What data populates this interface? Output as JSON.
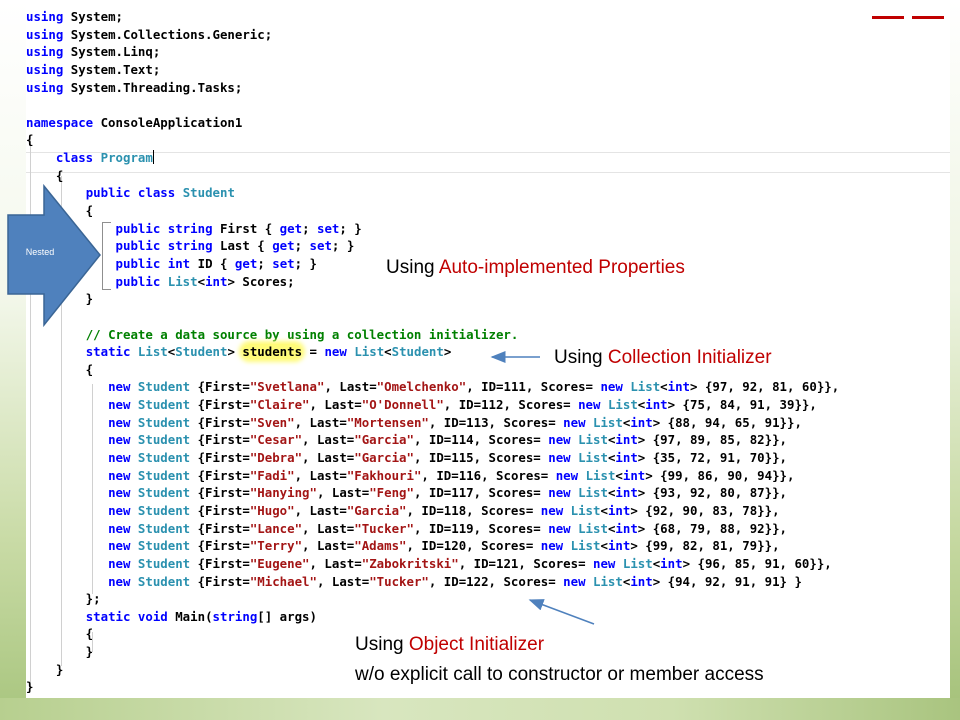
{
  "code_lines": [
    [
      {
        "t": "using",
        "c": "kw"
      },
      {
        "t": " System;"
      }
    ],
    [
      {
        "t": "using",
        "c": "kw"
      },
      {
        "t": " System.Collections.Generic;"
      }
    ],
    [
      {
        "t": "using",
        "c": "kw"
      },
      {
        "t": " System.Linq;"
      }
    ],
    [
      {
        "t": "using",
        "c": "kw"
      },
      {
        "t": " System.Text;"
      }
    ],
    [
      {
        "t": "using",
        "c": "kw"
      },
      {
        "t": " System.Threading.Tasks;"
      }
    ],
    [],
    [
      {
        "t": "namespace",
        "c": "kw"
      },
      {
        "t": " ConsoleApplication1"
      }
    ],
    [
      {
        "t": "{"
      }
    ],
    [
      {
        "t": "    "
      },
      {
        "t": "class",
        "c": "kw"
      },
      {
        "t": " "
      },
      {
        "t": "Program",
        "c": "ty"
      },
      {
        "caret": true
      }
    ],
    [
      {
        "t": "    {"
      }
    ],
    [
      {
        "t": "        "
      },
      {
        "t": "public",
        "c": "kw"
      },
      {
        "t": " "
      },
      {
        "t": "class",
        "c": "kw"
      },
      {
        "t": " "
      },
      {
        "t": "Student",
        "c": "ty"
      }
    ],
    [
      {
        "t": "        {"
      }
    ],
    [
      {
        "t": "            "
      },
      {
        "t": "public",
        "c": "kw"
      },
      {
        "t": " "
      },
      {
        "t": "string",
        "c": "kw"
      },
      {
        "t": " First { "
      },
      {
        "t": "get",
        "c": "kw"
      },
      {
        "t": "; "
      },
      {
        "t": "set",
        "c": "kw"
      },
      {
        "t": "; }"
      }
    ],
    [
      {
        "t": "            "
      },
      {
        "t": "public",
        "c": "kw"
      },
      {
        "t": " "
      },
      {
        "t": "string",
        "c": "kw"
      },
      {
        "t": " Last { "
      },
      {
        "t": "get",
        "c": "kw"
      },
      {
        "t": "; "
      },
      {
        "t": "set",
        "c": "kw"
      },
      {
        "t": "; }"
      }
    ],
    [
      {
        "t": "            "
      },
      {
        "t": "public",
        "c": "kw"
      },
      {
        "t": " "
      },
      {
        "t": "int",
        "c": "kw"
      },
      {
        "t": " ID { "
      },
      {
        "t": "get",
        "c": "kw"
      },
      {
        "t": "; "
      },
      {
        "t": "set",
        "c": "kw"
      },
      {
        "t": "; }"
      }
    ],
    [
      {
        "t": "            "
      },
      {
        "t": "public",
        "c": "kw"
      },
      {
        "t": " "
      },
      {
        "t": "List",
        "c": "ty"
      },
      {
        "t": "<"
      },
      {
        "t": "int",
        "c": "kw"
      },
      {
        "t": "> Scores;"
      }
    ],
    [
      {
        "t": "        }"
      }
    ],
    [],
    [
      {
        "t": "        "
      },
      {
        "t": "// Create a data source by using a collection initializer.",
        "c": "cm"
      }
    ],
    [
      {
        "t": "        "
      },
      {
        "t": "static",
        "c": "kw"
      },
      {
        "t": " "
      },
      {
        "t": "List",
        "c": "ty"
      },
      {
        "t": "<"
      },
      {
        "t": "Student",
        "c": "ty"
      },
      {
        "t": "> "
      },
      {
        "t": "students",
        "hl": true
      },
      {
        "t": " = "
      },
      {
        "t": "new",
        "c": "kw"
      },
      {
        "t": " "
      },
      {
        "t": "List",
        "c": "ty"
      },
      {
        "t": "<"
      },
      {
        "t": "Student",
        "c": "ty"
      },
      {
        "t": ">"
      }
    ],
    [
      {
        "t": "        {"
      }
    ],
    [
      {
        "t": "           "
      },
      {
        "t": "new",
        "c": "kw"
      },
      {
        "t": " "
      },
      {
        "t": "Student",
        "c": "ty"
      },
      {
        "t": " {First="
      },
      {
        "t": "\"Svetlana\"",
        "c": "st"
      },
      {
        "t": ", Last="
      },
      {
        "t": "\"Omelchenko\"",
        "c": "st"
      },
      {
        "t": ", ID=111, Scores= "
      },
      {
        "t": "new",
        "c": "kw"
      },
      {
        "t": " "
      },
      {
        "t": "List",
        "c": "ty"
      },
      {
        "t": "<"
      },
      {
        "t": "int",
        "c": "kw"
      },
      {
        "t": "> {97, 92, 81, 60}},"
      }
    ],
    [
      {
        "t": "           "
      },
      {
        "t": "new",
        "c": "kw"
      },
      {
        "t": " "
      },
      {
        "t": "Student",
        "c": "ty"
      },
      {
        "t": " {First="
      },
      {
        "t": "\"Claire\"",
        "c": "st"
      },
      {
        "t": ", Last="
      },
      {
        "t": "\"O'Donnell\"",
        "c": "st"
      },
      {
        "t": ", ID=112, Scores= "
      },
      {
        "t": "new",
        "c": "kw"
      },
      {
        "t": " "
      },
      {
        "t": "List",
        "c": "ty"
      },
      {
        "t": "<"
      },
      {
        "t": "int",
        "c": "kw"
      },
      {
        "t": "> {75, 84, 91, 39}},"
      }
    ],
    [
      {
        "t": "           "
      },
      {
        "t": "new",
        "c": "kw"
      },
      {
        "t": " "
      },
      {
        "t": "Student",
        "c": "ty"
      },
      {
        "t": " {First="
      },
      {
        "t": "\"Sven\"",
        "c": "st"
      },
      {
        "t": ", Last="
      },
      {
        "t": "\"Mortensen\"",
        "c": "st"
      },
      {
        "t": ", ID=113, Scores= "
      },
      {
        "t": "new",
        "c": "kw"
      },
      {
        "t": " "
      },
      {
        "t": "List",
        "c": "ty"
      },
      {
        "t": "<"
      },
      {
        "t": "int",
        "c": "kw"
      },
      {
        "t": "> {88, 94, 65, 91}},"
      }
    ],
    [
      {
        "t": "           "
      },
      {
        "t": "new",
        "c": "kw"
      },
      {
        "t": " "
      },
      {
        "t": "Student",
        "c": "ty"
      },
      {
        "t": " {First="
      },
      {
        "t": "\"Cesar\"",
        "c": "st"
      },
      {
        "t": ", Last="
      },
      {
        "t": "\"Garcia\"",
        "c": "st"
      },
      {
        "t": ", ID=114, Scores= "
      },
      {
        "t": "new",
        "c": "kw"
      },
      {
        "t": " "
      },
      {
        "t": "List",
        "c": "ty"
      },
      {
        "t": "<"
      },
      {
        "t": "int",
        "c": "kw"
      },
      {
        "t": "> {97, 89, 85, 82}},"
      }
    ],
    [
      {
        "t": "           "
      },
      {
        "t": "new",
        "c": "kw"
      },
      {
        "t": " "
      },
      {
        "t": "Student",
        "c": "ty"
      },
      {
        "t": " {First="
      },
      {
        "t": "\"Debra\"",
        "c": "st"
      },
      {
        "t": ", Last="
      },
      {
        "t": "\"Garcia\"",
        "c": "st"
      },
      {
        "t": ", ID=115, Scores= "
      },
      {
        "t": "new",
        "c": "kw"
      },
      {
        "t": " "
      },
      {
        "t": "List",
        "c": "ty"
      },
      {
        "t": "<"
      },
      {
        "t": "int",
        "c": "kw"
      },
      {
        "t": "> {35, 72, 91, 70}},"
      }
    ],
    [
      {
        "t": "           "
      },
      {
        "t": "new",
        "c": "kw"
      },
      {
        "t": " "
      },
      {
        "t": "Student",
        "c": "ty"
      },
      {
        "t": " {First="
      },
      {
        "t": "\"Fadi\"",
        "c": "st"
      },
      {
        "t": ", Last="
      },
      {
        "t": "\"Fakhouri\"",
        "c": "st"
      },
      {
        "t": ", ID=116, Scores= "
      },
      {
        "t": "new",
        "c": "kw"
      },
      {
        "t": " "
      },
      {
        "t": "List",
        "c": "ty"
      },
      {
        "t": "<"
      },
      {
        "t": "int",
        "c": "kw"
      },
      {
        "t": "> {99, 86, 90, 94}},"
      }
    ],
    [
      {
        "t": "           "
      },
      {
        "t": "new",
        "c": "kw"
      },
      {
        "t": " "
      },
      {
        "t": "Student",
        "c": "ty"
      },
      {
        "t": " {First="
      },
      {
        "t": "\"Hanying\"",
        "c": "st"
      },
      {
        "t": ", Last="
      },
      {
        "t": "\"Feng\"",
        "c": "st"
      },
      {
        "t": ", ID=117, Scores= "
      },
      {
        "t": "new",
        "c": "kw"
      },
      {
        "t": " "
      },
      {
        "t": "List",
        "c": "ty"
      },
      {
        "t": "<"
      },
      {
        "t": "int",
        "c": "kw"
      },
      {
        "t": "> {93, 92, 80, 87}},"
      }
    ],
    [
      {
        "t": "           "
      },
      {
        "t": "new",
        "c": "kw"
      },
      {
        "t": " "
      },
      {
        "t": "Student",
        "c": "ty"
      },
      {
        "t": " {First="
      },
      {
        "t": "\"Hugo\"",
        "c": "st"
      },
      {
        "t": ", Last="
      },
      {
        "t": "\"Garcia\"",
        "c": "st"
      },
      {
        "t": ", ID=118, Scores= "
      },
      {
        "t": "new",
        "c": "kw"
      },
      {
        "t": " "
      },
      {
        "t": "List",
        "c": "ty"
      },
      {
        "t": "<"
      },
      {
        "t": "int",
        "c": "kw"
      },
      {
        "t": "> {92, 90, 83, 78}},"
      }
    ],
    [
      {
        "t": "           "
      },
      {
        "t": "new",
        "c": "kw"
      },
      {
        "t": " "
      },
      {
        "t": "Student",
        "c": "ty"
      },
      {
        "t": " {First="
      },
      {
        "t": "\"Lance\"",
        "c": "st"
      },
      {
        "t": ", Last="
      },
      {
        "t": "\"Tucker\"",
        "c": "st"
      },
      {
        "t": ", ID=119, Scores= "
      },
      {
        "t": "new",
        "c": "kw"
      },
      {
        "t": " "
      },
      {
        "t": "List",
        "c": "ty"
      },
      {
        "t": "<"
      },
      {
        "t": "int",
        "c": "kw"
      },
      {
        "t": "> {68, 79, 88, 92}},"
      }
    ],
    [
      {
        "t": "           "
      },
      {
        "t": "new",
        "c": "kw"
      },
      {
        "t": " "
      },
      {
        "t": "Student",
        "c": "ty"
      },
      {
        "t": " {First="
      },
      {
        "t": "\"Terry\"",
        "c": "st"
      },
      {
        "t": ", Last="
      },
      {
        "t": "\"Adams\"",
        "c": "st"
      },
      {
        "t": ", ID=120, Scores= "
      },
      {
        "t": "new",
        "c": "kw"
      },
      {
        "t": " "
      },
      {
        "t": "List",
        "c": "ty"
      },
      {
        "t": "<"
      },
      {
        "t": "int",
        "c": "kw"
      },
      {
        "t": "> {99, 82, 81, 79}},"
      }
    ],
    [
      {
        "t": "           "
      },
      {
        "t": "new",
        "c": "kw"
      },
      {
        "t": " "
      },
      {
        "t": "Student",
        "c": "ty"
      },
      {
        "t": " {First="
      },
      {
        "t": "\"Eugene\"",
        "c": "st"
      },
      {
        "t": ", Last="
      },
      {
        "t": "\"Zabokritski\"",
        "c": "st"
      },
      {
        "t": ", ID=121, Scores= "
      },
      {
        "t": "new",
        "c": "kw"
      },
      {
        "t": " "
      },
      {
        "t": "List",
        "c": "ty"
      },
      {
        "t": "<"
      },
      {
        "t": "int",
        "c": "kw"
      },
      {
        "t": "> {96, 85, 91, 60}},"
      }
    ],
    [
      {
        "t": "           "
      },
      {
        "t": "new",
        "c": "kw"
      },
      {
        "t": " "
      },
      {
        "t": "Student",
        "c": "ty"
      },
      {
        "t": " {First="
      },
      {
        "t": "\"Michael\"",
        "c": "st"
      },
      {
        "t": ", Last="
      },
      {
        "t": "\"Tucker\"",
        "c": "st"
      },
      {
        "t": ", ID=122, Scores= "
      },
      {
        "t": "new",
        "c": "kw"
      },
      {
        "t": " "
      },
      {
        "t": "List",
        "c": "ty"
      },
      {
        "t": "<"
      },
      {
        "t": "int",
        "c": "kw"
      },
      {
        "t": "> {94, 92, 91, 91} }"
      }
    ],
    [
      {
        "t": "        };"
      }
    ],
    [
      {
        "t": "        "
      },
      {
        "t": "static",
        "c": "kw"
      },
      {
        "t": " "
      },
      {
        "t": "void",
        "c": "kw"
      },
      {
        "t": " Main("
      },
      {
        "t": "string",
        "c": "kw"
      },
      {
        "t": "[] args)"
      }
    ],
    [
      {
        "t": "        {"
      }
    ],
    [
      {
        "t": "        }"
      }
    ],
    [
      {
        "t": "    }"
      }
    ],
    [
      {
        "t": "}"
      }
    ]
  ],
  "annotations": {
    "auto_props": {
      "prefix": "Using ",
      "highlight": "Auto-implemented Properties"
    },
    "collection_init": {
      "prefix": "Using ",
      "highlight": "Collection Initializer"
    },
    "object_init": {
      "prefix": "Using ",
      "highlight": "Object Initializer",
      "line2": "w/o explicit call to constructor or member access"
    }
  },
  "nested_label": "Nested",
  "colors": {
    "keyword": "#0000ff",
    "type": "#2b91af",
    "string": "#a31515",
    "comment": "#008000",
    "annotation_highlight": "#c00000",
    "nested_arrow": "#4f81bd",
    "highlight": "#fffb7a"
  }
}
